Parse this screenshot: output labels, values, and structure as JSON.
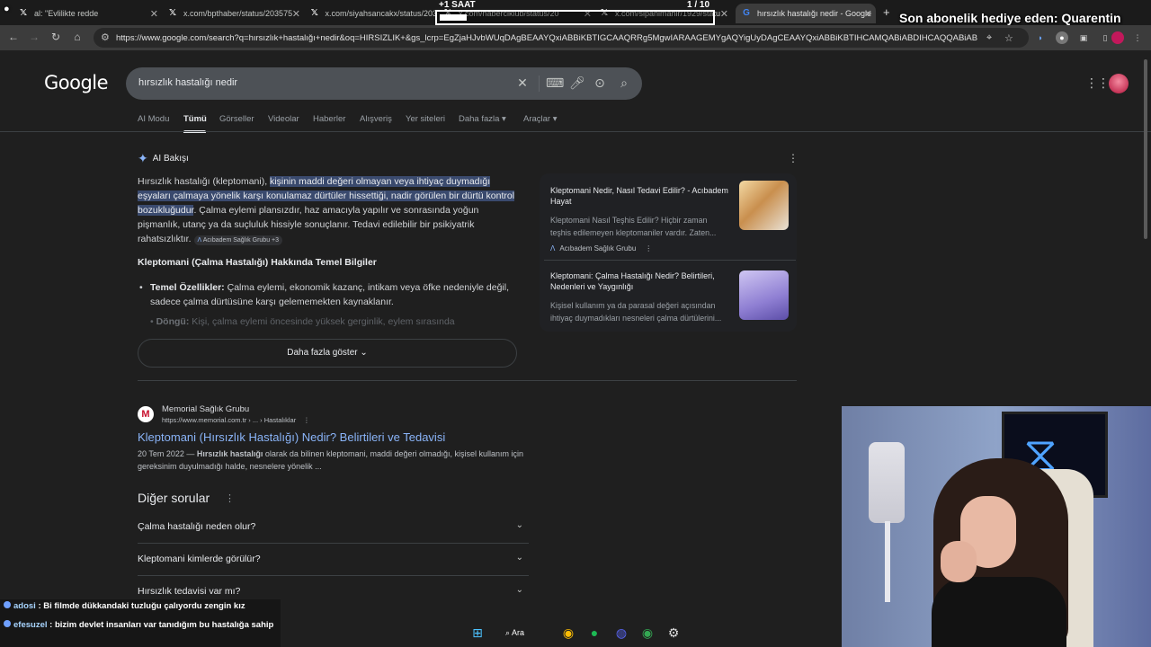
{
  "browser": {
    "tabs": [
      {
        "title": "al: \"Evlilikte redde",
        "favicon": "x-icon",
        "close": "✕"
      },
      {
        "title": "x.com/bpthaber/status/203575",
        "favicon": "x-icon",
        "close": "✕"
      },
      {
        "title": "x.com/siyahsancakx/status/203",
        "favicon": "x-icon",
        "close": "✕"
      },
      {
        "title": "x.com/haberciklub/status/20",
        "favicon": "x-icon",
        "close": "✕"
      },
      {
        "title": "x.com/sipahimahir/1929/statu",
        "favicon": "x-icon",
        "close": "✕"
      },
      {
        "title": "hırsızlık hastalığı nedir - Google",
        "favicon": "google-icon",
        "close": "✕"
      }
    ],
    "new_tab": "+",
    "url": "https://www.google.com/search?q=hırsızlık+hastalığı+nedir&oq=HIRSIZLIK+&gs_lcrp=EgZjaHJvbWUqDAgBEAAYQxiABBiKBTIGCAAQRRg5MgwIARAAGEMYgAQYigUyDAgCEAAYQxiABBiKBTIHCAMQABiABDIHCAQQABiABDIHCAUQA..."
  },
  "google": {
    "logo": "Google",
    "query": "hırsızlık hastalığı nedir",
    "tabs": [
      "AI Modu",
      "Tümü",
      "Görseller",
      "Videolar",
      "Haberler",
      "Alışveriş",
      "Yer siteleri",
      "Daha fazla ▾",
      "Araçlar ▾"
    ],
    "ai_overview": {
      "label": "AI Bakışı",
      "text_pre": "Hırsızlık hastalığı (kleptomani), ",
      "text_highlight": "kişinin maddi değeri olmayan veya ihtiyaç duymadığı eşyaları çalmaya yönelik karşı konulamaz dürtüler hissettiği, nadir görülen bir dürtü kontrol bozukluğudur",
      "text_post": ". Çalma eylemi plansızdır, haz amacıyla yapılır ve sonrasında yoğun pişmanlık, utanç ya da suçluluk hissiyle sonuçlanır. Tedavi edilebilir bir psikiyatrik rahatsızlıktır.",
      "citation_chip": "Acıbadem Sağlık Grubu +3",
      "subheading": "Kleptomani (Çalma Hastalığı) Hakkında Temel Bilgiler",
      "bullet_label": "Temel Özellikler:",
      "bullet_text": " Çalma eylemi, ekonomik kazanç, intikam veya öfke nedeniyle değil, sadece çalma dürtüsüne karşı gelememekten kaynaklanır.",
      "faded_label": "Döngü:",
      "faded_text": " Kişi, çalma eylemi öncesinde yüksek gerginlik, eylem sırasında",
      "more_button": "Daha fazla göster"
    },
    "source_cards": [
      {
        "title": "Kleptomani Nedir, Nasıl Tedavi Edilir? - Acıbadem Hayat",
        "desc": "Kleptomani Nasıl Teşhis Edilir? Hiçbir zaman teşhis edilemeyen kleptomaniler vardır. Zaten...",
        "source": "Acıbadem Sağlık Grubu"
      },
      {
        "title": "Kleptomani: Çalma Hastalığı Nedir? Belirtileri, Nedenleri ve Yaygınlığı",
        "desc": "Kişisel kullanım ya da parasal değeri açısından ihtiyaç duymadıkları nesneleri çalma dürtülerini...",
        "source": ""
      }
    ],
    "result": {
      "site": "Memorial Sağlık Grubu",
      "url": "https://www.memorial.com.tr › ... › Hastalıklar",
      "title": "Kleptomani (Hırsızlık Hastalığı) Nedir? Belirtileri ve Tedavisi",
      "date": "20 Tem 2022 — ",
      "snip_bold": "Hırsızlık hastalığı",
      "snip_rest": " olarak da bilinen kleptomani, maddi değeri olmadığı, kişisel kullanım için gereksinim duyulmadığı halde, nesnelere yönelik ..."
    },
    "paa": {
      "title": "Diğer sorular",
      "items": [
        "Çalma hastalığı neden olur?",
        "Kleptomani kimlerde görülür?",
        "Hırsızlık tedavisi var mı?"
      ]
    }
  },
  "stream": {
    "timer_label": "+1 SAAT",
    "counter": "1 / 10",
    "progress_fraction": 0.1,
    "subscription_text": "Son abonelik hediye eden: Quarentin",
    "chat": [
      {
        "user": "adosi",
        "message": " : Bi filmde dükkandaki tuzluğu çalıyordu zengin kız"
      },
      {
        "user": "efesuzel",
        "message": " : bizim devlet insanları var tanıdığım bu hastalığa sahip"
      }
    ]
  },
  "taskbar": {
    "search_label": "Ara",
    "icons": [
      "windows-icon",
      "search-icon",
      "chrome-icon",
      "spotify-icon",
      "discord-icon",
      "chrome-icon",
      "settings-icon"
    ]
  },
  "colors": {
    "link": "#8ab4f8",
    "highlight": "#3a4a6e",
    "page_bg": "#1f1f1f"
  }
}
